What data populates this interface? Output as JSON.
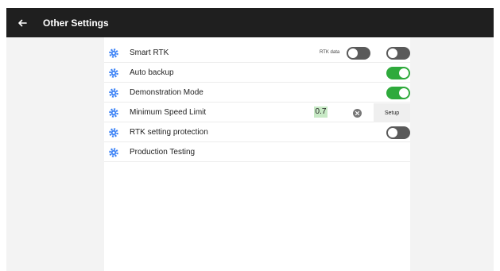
{
  "header": {
    "back_icon": "arrow-left-icon",
    "title": "Other Settings"
  },
  "settings": {
    "row_icon": "gear-icon",
    "smart_rtk": {
      "label": "Smart RTK",
      "rtk_data_label": "RTK data",
      "rtk_data_enabled": false,
      "enabled": false
    },
    "auto_backup": {
      "label": "Auto backup",
      "enabled": true
    },
    "demonstration_mode": {
      "label": "Demonstration Mode",
      "enabled": true
    },
    "minimum_speed_limit": {
      "label": "Minimum Speed Limit",
      "value": "0.7",
      "clear_icon": "close-circle-icon",
      "setup_label": "Setup"
    },
    "rtk_setting_protection": {
      "label": "RTK setting protection",
      "enabled": false
    },
    "production_testing": {
      "label": "Production Testing"
    }
  },
  "colors": {
    "header_bg": "#1f1f1f",
    "toggle_on": "#2faa3c",
    "toggle_off": "#5a5a5a",
    "gear_icon": "#3b82f6",
    "value_highlight": "#c7e9c5"
  }
}
